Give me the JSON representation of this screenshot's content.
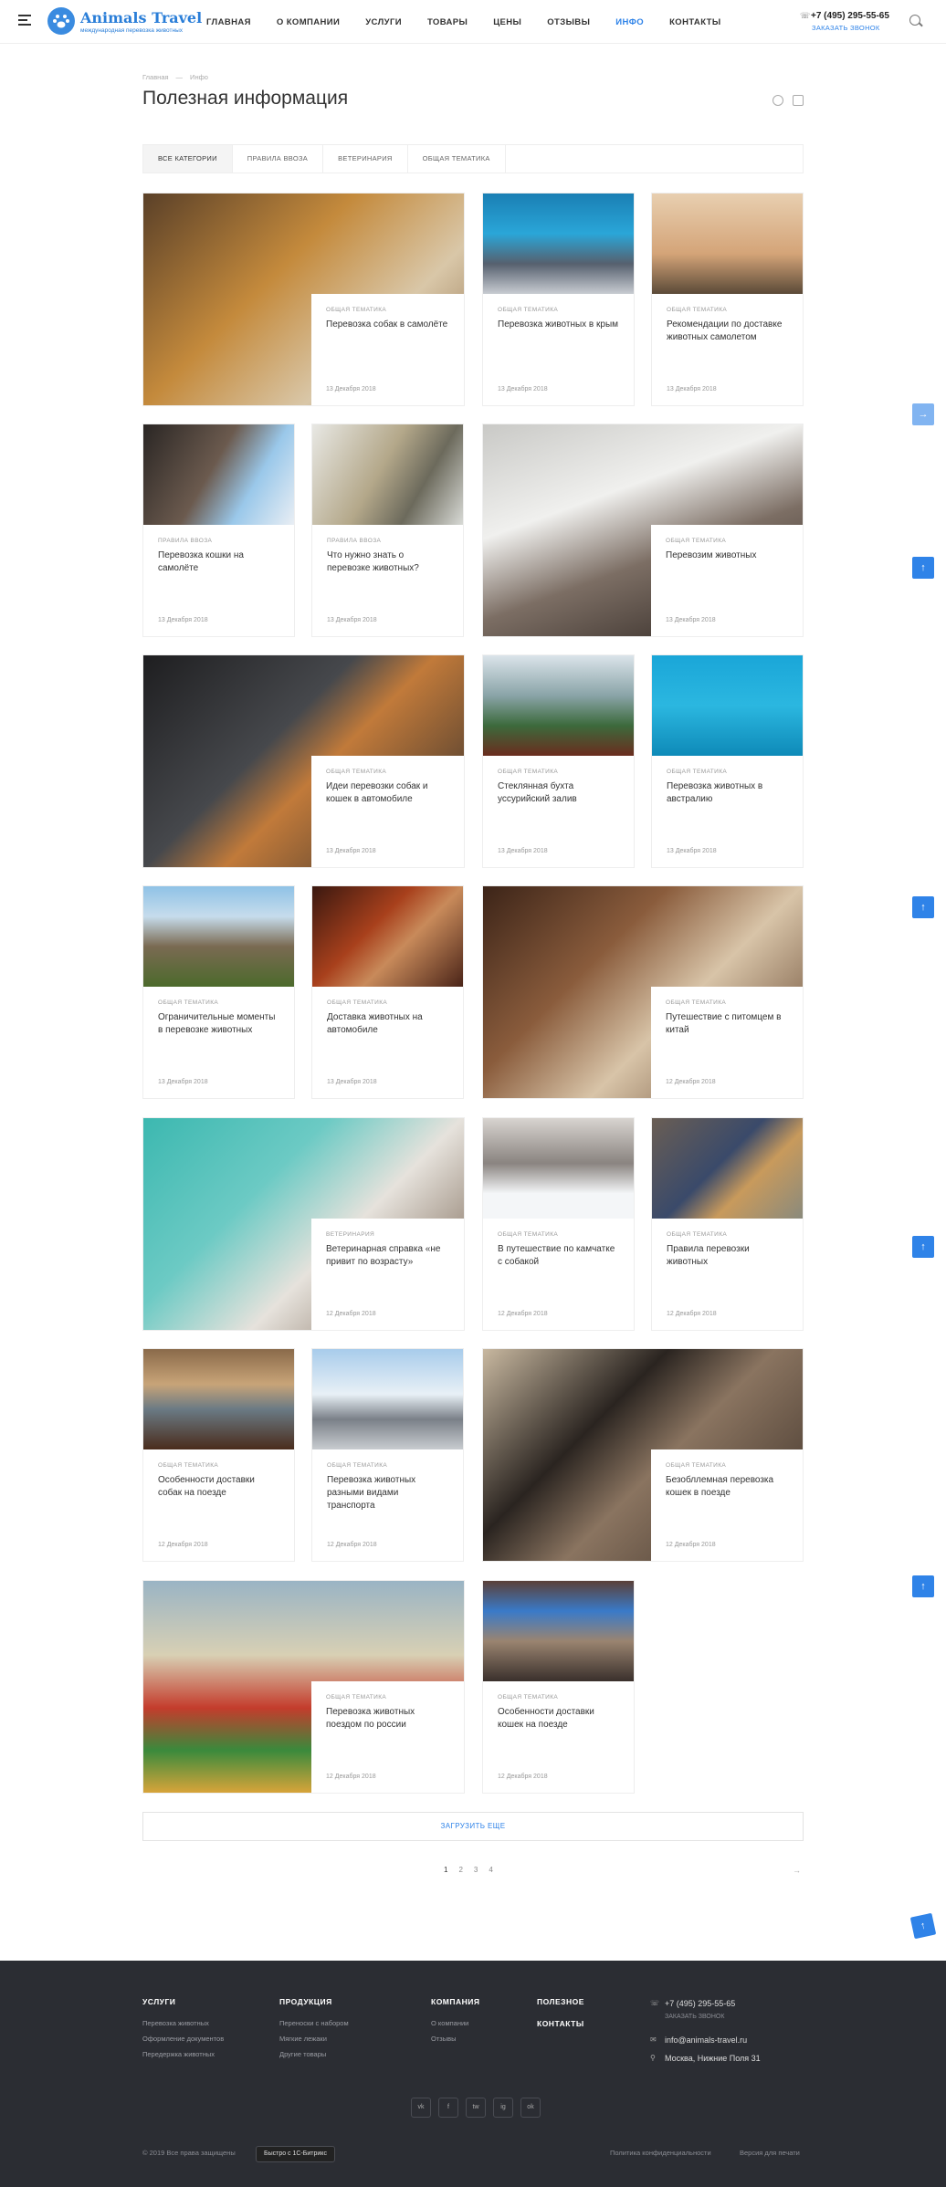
{
  "header": {
    "logo_name": "Animals Travel",
    "logo_sub": "международная перевозка животных",
    "nav": [
      "Главная",
      "О компании",
      "Услуги",
      "Товары",
      "Цены",
      "Отзывы",
      "Инфо",
      "Контакты"
    ],
    "active_nav": "Инфо",
    "phone": "+7 (495) 295-55-65",
    "callback": "Заказать звонок"
  },
  "breadcrumb": [
    "Главная",
    "—",
    "Инфо"
  ],
  "title": "Полезная информация",
  "tabs": [
    "Все категории",
    "Правила ввоза",
    "Ветеринария",
    "Общая тематика"
  ],
  "cards": [
    {
      "cat": "Общая тематика",
      "title": "Перевозка собак в самолёте",
      "date": "13 Декабря 2018"
    },
    {
      "cat": "Общая тематика",
      "title": "Перевозка животных в крым",
      "date": "13 Декабря 2018"
    },
    {
      "cat": "Общая тематика",
      "title": "Рекомендации по доставке животных самолетом",
      "date": "13 Декабря 2018"
    },
    {
      "cat": "Правила ввоза",
      "title": "Перевозка кошки на самолёте",
      "date": "13 Декабря 2018"
    },
    {
      "cat": "Правила ввоза",
      "title": "Что нужно знать о перевозке животных?",
      "date": "13 Декабря 2018"
    },
    {
      "cat": "Общая тематика",
      "title": "Перевозим животных",
      "date": "13 Декабря 2018"
    },
    {
      "cat": "Общая тематика",
      "title": "Идеи перевозки собак и кошек в автомобиле",
      "date": "13 Декабря 2018"
    },
    {
      "cat": "Общая тематика",
      "title": "Стеклянная бухта уссурийский залив",
      "date": "13 Декабря 2018"
    },
    {
      "cat": "Общая тематика",
      "title": "Перевозка животных в австралию",
      "date": "13 Декабря 2018"
    },
    {
      "cat": "Общая тематика",
      "title": "Ограничительные моменты в перевозке животных",
      "date": "13 Декабря 2018"
    },
    {
      "cat": "Общая тематика",
      "title": "Доставка животных на автомобиле",
      "date": "13 Декабря 2018"
    },
    {
      "cat": "Общая тематика",
      "title": "Путешествие с питомцем в китай",
      "date": "12 Декабря 2018"
    },
    {
      "cat": "Ветеринария",
      "title": "Ветеринарная справка «не привит по возрасту»",
      "date": "12 Декабря 2018"
    },
    {
      "cat": "Общая тематика",
      "title": "В путешествие по камчатке с собакой",
      "date": "12 Декабря 2018"
    },
    {
      "cat": "Общая тематика",
      "title": "Правила перевозки животных",
      "date": "12 Декабря 2018"
    },
    {
      "cat": "Общая тематика",
      "title": "Особенности доставки собак на поезде",
      "date": "12 Декабря 2018"
    },
    {
      "cat": "Общая тематика",
      "title": "Перевозка животных разными видами транспорта",
      "date": "12 Декабря 2018"
    },
    {
      "cat": "Общая тематика",
      "title": "Безобллемная перевозка кошек в поезде",
      "date": "12 Декабря 2018"
    },
    {
      "cat": "Общая тематика",
      "title": "Перевозка животных поездом по россии",
      "date": "12 Декабря 2018"
    },
    {
      "cat": "Общая тематика",
      "title": "Особенности доставки кошек на поезде",
      "date": "12 Декабря 2018"
    }
  ],
  "load_more": "Загрузить еще",
  "pages": [
    "1",
    "2",
    "3",
    "4"
  ],
  "pager_next": "→",
  "footer": {
    "cols": [
      {
        "head": "Услуги",
        "links": [
          "Перевозка животных",
          "Оформление документов",
          "Передержка животных"
        ]
      },
      {
        "head": "Продукция",
        "links": [
          "Переноски с набором",
          "Мягкие лежаки",
          "Другие товары"
        ]
      },
      {
        "head": "Компания",
        "links": [
          "О компании",
          "Отзывы"
        ]
      },
      {
        "head": "Полезное",
        "links": []
      }
    ],
    "contacts_head": "Контакты",
    "phone": "+7 (495) 295-55-65",
    "callback": "Заказать звонок",
    "email": "info@animals-travel.ru",
    "address": "Москва, Нижние Поля 31",
    "socials": [
      "vk",
      "f",
      "tw",
      "ig",
      "ok"
    ],
    "copyright": "© 2019 Все права защищены",
    "bitrix": "Быстро с 1С-Битрикс",
    "privacy": "Политика конфиденциальности",
    "print": "Версия для печати"
  },
  "colors": {
    "accent": "#2f83e8",
    "footer_bg": "#2b2d33"
  }
}
